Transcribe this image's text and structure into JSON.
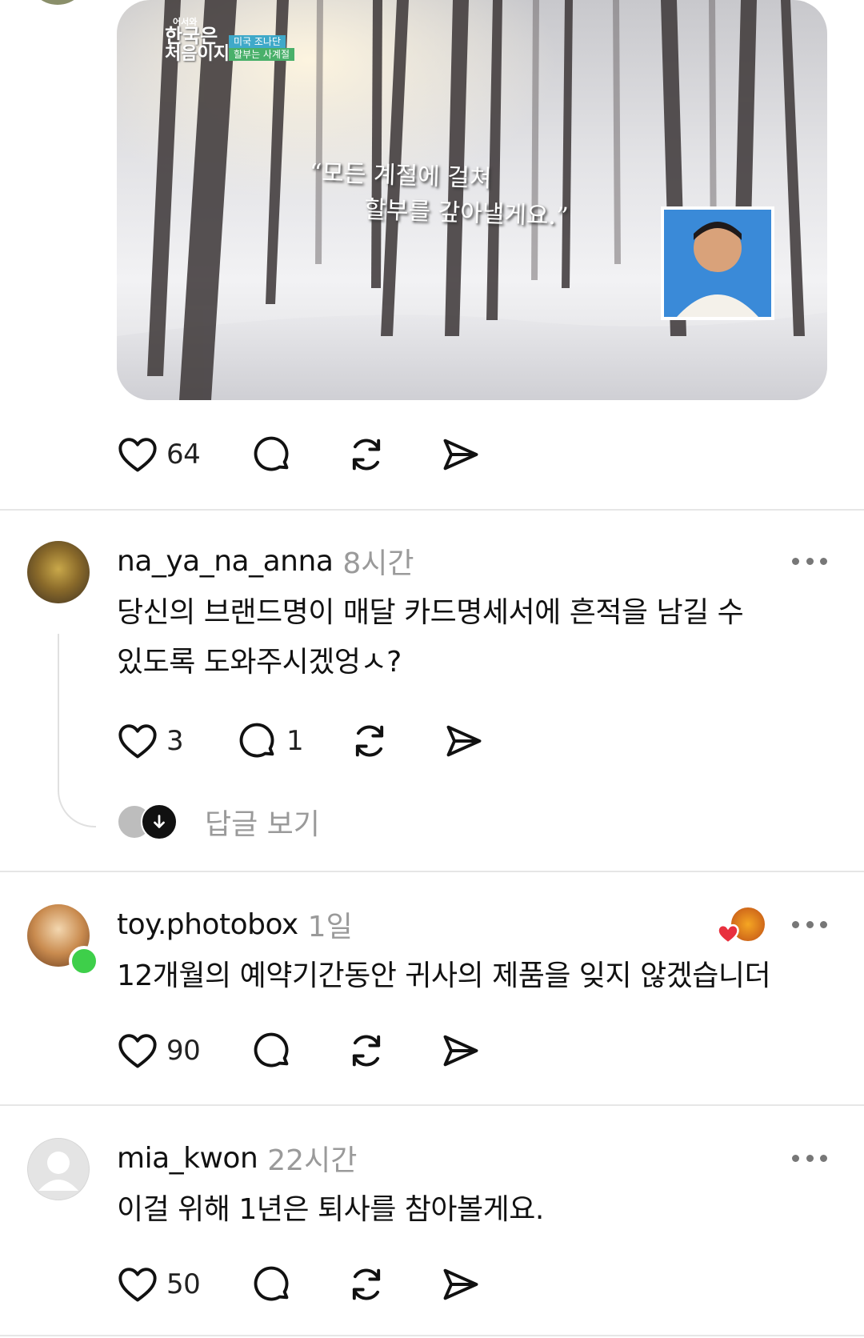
{
  "post": {
    "media": {
      "badge_small": "어서와",
      "badge_title_line1": "한국은",
      "badge_title_line2": "처음이지?",
      "tag_line1": "미국 조나단",
      "tag_line2": "할부는 사계절",
      "caption_line1": "“모든 계절에 걸쳐",
      "caption_line2": "할부를 갚아낼게요.”"
    },
    "likes": "64"
  },
  "comments": [
    {
      "username": "na_ya_na_anna",
      "time": "8시간",
      "text": "당신의 브랜드명이 매달 카드명세서에 흔적을 남길 수 있도록 도와주시겠엉ㅅ?",
      "likes": "3",
      "replies": "1",
      "view_replies_label": "답글 보기"
    },
    {
      "username": "toy.photobox",
      "time": "1일",
      "text": "12개월의 예약기간동안 귀사의 제품을 잊지 않겠습니더",
      "likes": "90"
    },
    {
      "username": "mia_kwon",
      "time": "22시간",
      "text": "이걸 위해 1년은 퇴사를 참아볼게요.",
      "likes": "50"
    }
  ],
  "colors": {
    "text": "#111111",
    "muted": "#9a9a9a",
    "divider": "#e6e6e6",
    "online": "#3ecf4a",
    "heart_badge": "#e8303e"
  },
  "icons": [
    "heart-icon",
    "comment-icon",
    "repost-icon",
    "share-icon",
    "more-icon",
    "arrow-down-icon"
  ]
}
